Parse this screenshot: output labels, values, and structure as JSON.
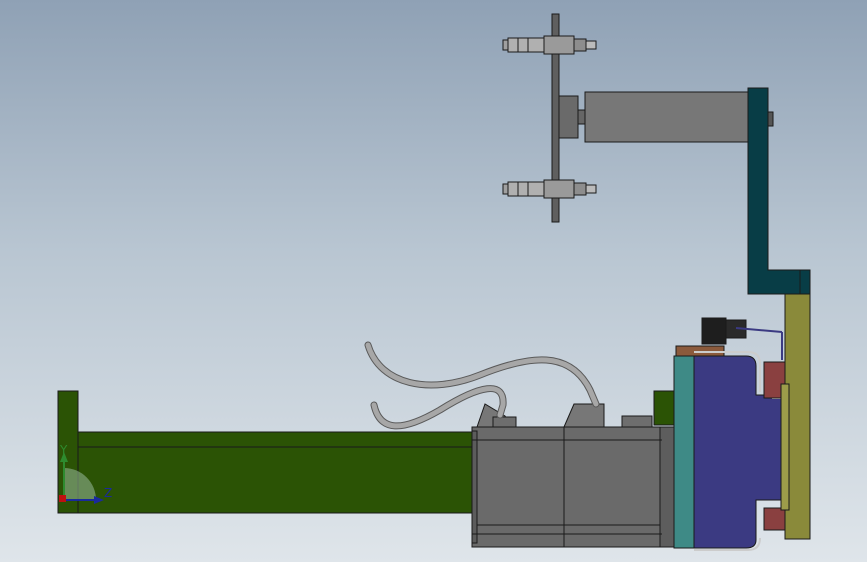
{
  "viewport": {
    "background_top": "#8fa1b5",
    "background_bottom": "#dfe5ea"
  },
  "model": {
    "parts": [
      {
        "name": "linear-actuator-rail",
        "color": "#2b5305"
      },
      {
        "name": "servo-motor",
        "color": "#6a6a6a"
      },
      {
        "name": "motor-cable",
        "color": "#a7a7a7"
      },
      {
        "name": "adapter-plate",
        "color": "#3e8a86"
      },
      {
        "name": "gearbox-housing",
        "color": "#3b3a82"
      },
      {
        "name": "mounting-plate",
        "color": "#8a8a3a"
      },
      {
        "name": "vertical-bracket",
        "color": "#083d46"
      },
      {
        "name": "cylinder-body",
        "color": "#777777"
      },
      {
        "name": "guide-plate",
        "color": "#5f5f5f"
      },
      {
        "name": "proximity-sensor",
        "color": "#1e1e1e"
      },
      {
        "name": "red-spacer",
        "color": "#8a4040"
      }
    ]
  },
  "triad": {
    "y_label": "Y",
    "z_label": "Z",
    "y_color": "#2e8b2e",
    "z_color": "#1a2a9c",
    "x_color": "#c01010"
  }
}
